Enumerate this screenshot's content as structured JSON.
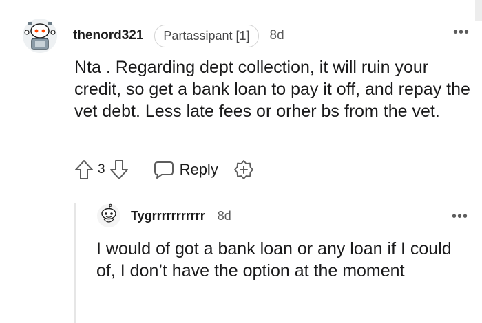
{
  "comments": [
    {
      "username": "thenord321",
      "flair": "Partassipant [1]",
      "time": "8d",
      "body": "Nta . Regarding dept collection, it will ruin your credit, so get a bank loan to pay it off, and repay the vet debt. Less late fees or orher bs from the vet.",
      "votes": "3",
      "reply_label": "Reply",
      "more_label": "•••"
    },
    {
      "username": "Tygrrrrrrrrrrr",
      "time": "8d",
      "body": "I would of got a bank loan or any loan if I could of, I don’t have the option at the moment",
      "more_label": "•••"
    }
  ],
  "icons": {
    "upvote": "arrow-up-icon",
    "downvote": "arrow-down-icon",
    "reply": "chat-bubble-icon",
    "award": "add-award-icon",
    "more": "more-options-icon"
  },
  "colors": {
    "text": "#1a1a1b",
    "meta": "#5c5c5c",
    "flair_border": "#d4d4d4",
    "thread_line": "#e6e6e6",
    "avatar_eye": "#ff4500"
  }
}
